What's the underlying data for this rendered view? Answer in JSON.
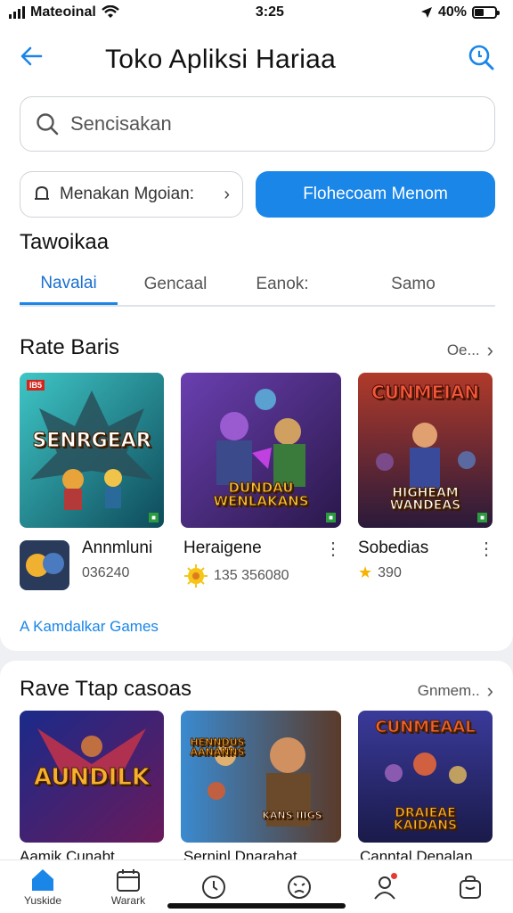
{
  "status": {
    "carrier": "Mateoinal",
    "time": "3:25",
    "battery": "40%"
  },
  "header": {
    "title": "Toko Apliksi Hariaa"
  },
  "search": {
    "placeholder": "Sencisakan"
  },
  "filter": {
    "label": "Menakan Mgoian:",
    "chevron": "›"
  },
  "primary_button": {
    "label": "Flohecoam Menom"
  },
  "section_label": "Tawoikaa",
  "tabs": [
    {
      "label": "Navalai",
      "active": true
    },
    {
      "label": "Gencaal",
      "active": false
    },
    {
      "label": "Eanok:",
      "active": false
    },
    {
      "label": "Samo",
      "active": false
    }
  ],
  "row1": {
    "title": "Rate Baris",
    "more": "Oe...",
    "cards": [
      {
        "banner": "SENRGEAR",
        "age": "IB5"
      },
      {
        "banner": "DUNDAU WENLAKANS",
        "age": ""
      },
      {
        "banner": "CUNMEIAN",
        "banner2": "HIGHEAM WANDEAS",
        "age": ""
      }
    ],
    "infos": [
      {
        "title": "Annmluni",
        "meta": "036240"
      },
      {
        "title": "Heraigene",
        "meta": "135 356080"
      },
      {
        "title": "Sobedias",
        "meta": "390"
      }
    ],
    "footer_link": "A Kamdalkar Games"
  },
  "row2": {
    "title": "Rave Ttap casoas",
    "more": "Gnmem..",
    "cards": [
      {
        "banner": "AUNDILK"
      },
      {
        "banner": "HENNDUS AANANNS",
        "banner2": "KANS IIIGS"
      },
      {
        "banner": "CUNMEAAL",
        "banner2": "DRAIEAE KAIDANS"
      }
    ],
    "titles": [
      "Aamik Cunabt",
      "Serninl Dnarahat",
      "Canntal Denalan"
    ]
  },
  "nav": [
    {
      "label": "Yuskide",
      "icon": "home-icon",
      "active": true
    },
    {
      "label": "Warark",
      "icon": "calendar-icon",
      "active": false
    },
    {
      "label": "",
      "icon": "clock-icon",
      "active": false
    },
    {
      "label": "",
      "icon": "game-face-icon",
      "active": false
    },
    {
      "label": "",
      "icon": "profile-icon",
      "active": false
    },
    {
      "label": "",
      "icon": "bag-icon",
      "active": false
    }
  ],
  "colors": {
    "accent": "#1a86e8",
    "accent_dark": "#1a6fd0"
  }
}
